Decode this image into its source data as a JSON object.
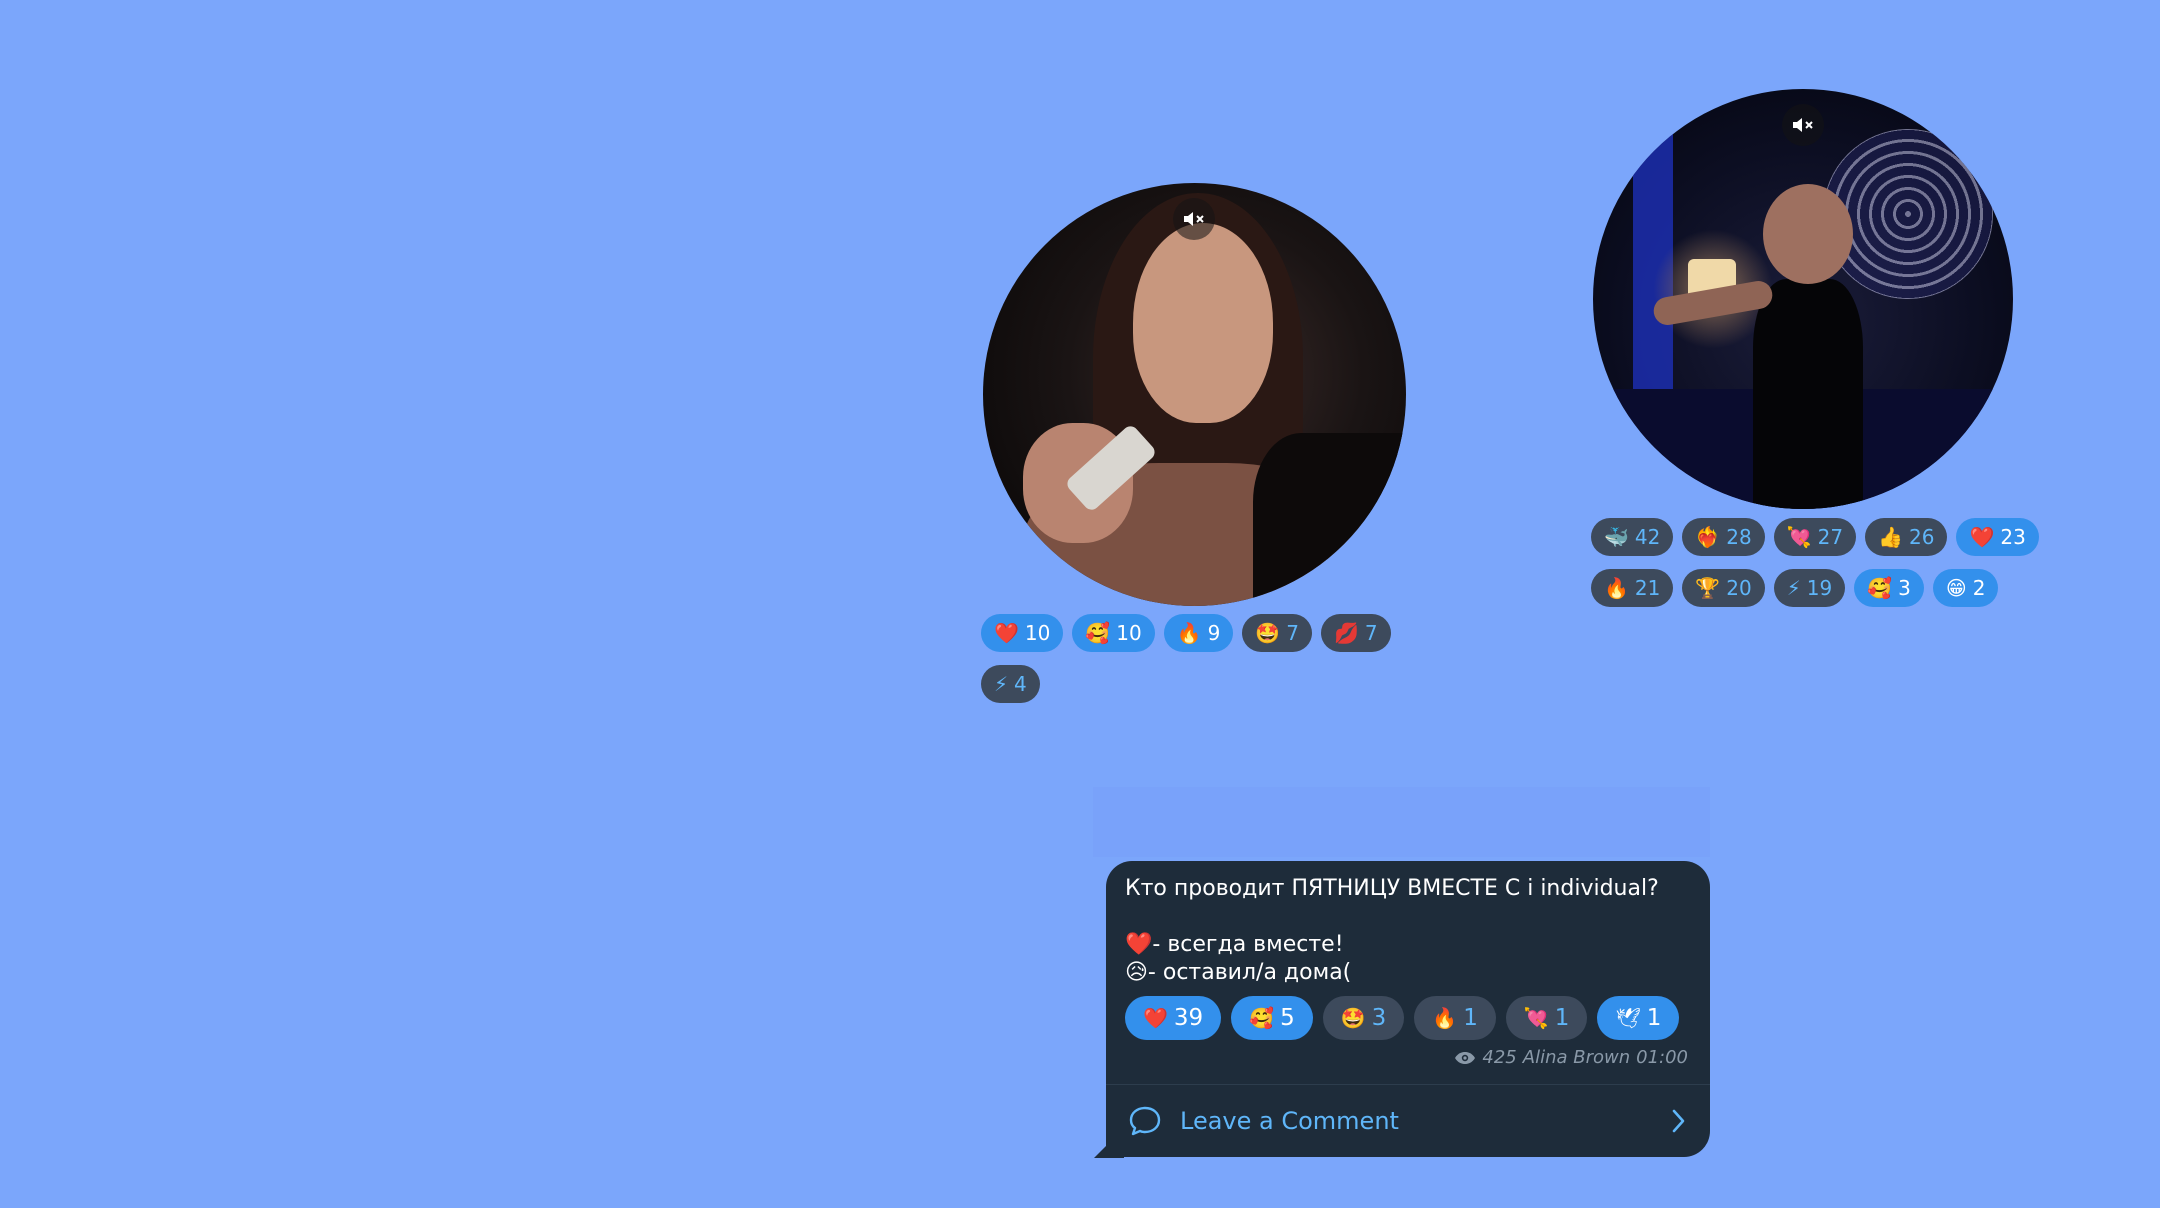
{
  "video1": {
    "mute_icon": "speaker-muted-icon"
  },
  "video2": {
    "mute_icon": "speaker-muted-icon"
  },
  "reactions1": [
    {
      "emoji": "❤️",
      "count": "10",
      "style": "chosen"
    },
    {
      "emoji": "🥰",
      "count": "10",
      "style": "chosen"
    },
    {
      "emoji": "🔥",
      "count": "9",
      "style": "chosen"
    },
    {
      "emoji": "🤩",
      "count": "7",
      "style": "dark"
    },
    {
      "emoji": "💋",
      "count": "7",
      "style": "dark"
    },
    {
      "emoji": "⚡",
      "count": "4",
      "style": "dark"
    }
  ],
  "reactions2": [
    {
      "emoji": "🐳",
      "count": "42",
      "style": "dark"
    },
    {
      "emoji": "❤️‍🔥",
      "count": "28",
      "style": "dark"
    },
    {
      "emoji": "💘",
      "count": "27",
      "style": "dark"
    },
    {
      "emoji": "👍",
      "count": "26",
      "style": "dark"
    },
    {
      "emoji": "❤️",
      "count": "23",
      "style": "chosen"
    },
    {
      "emoji": "🔥",
      "count": "21",
      "style": "dark"
    },
    {
      "emoji": "🏆",
      "count": "20",
      "style": "dark"
    },
    {
      "emoji": "⚡",
      "count": "19",
      "style": "dark"
    },
    {
      "emoji": "🥰",
      "count": "3",
      "style": "chosen"
    },
    {
      "emoji": "😁",
      "count": "2",
      "style": "chosen"
    }
  ],
  "message": {
    "text": "Кто проводит ПЯТНИЦУ ВМЕСТЕ С i individual?\n\n❤️- всегда вместе!\n😥- оставил/а дома(",
    "reactions": [
      {
        "emoji": "❤️",
        "count": "39",
        "style": "chosen"
      },
      {
        "emoji": "🥰",
        "count": "5",
        "style": "chosen"
      },
      {
        "emoji": "🤩",
        "count": "3",
        "style": "dark"
      },
      {
        "emoji": "🔥",
        "count": "1",
        "style": "dark"
      },
      {
        "emoji": "💘",
        "count": "1",
        "style": "dark"
      },
      {
        "emoji": "🕊",
        "count": "1",
        "style": "chosen"
      }
    ],
    "views": "425",
    "author": "Alina Brown",
    "time": "01:00",
    "comment_label": "Leave a Comment"
  },
  "colors": {
    "background": "#7ba6fb",
    "bubble": "#1e2c3a",
    "accent": "#3390ec",
    "link": "#5fb6f9"
  }
}
